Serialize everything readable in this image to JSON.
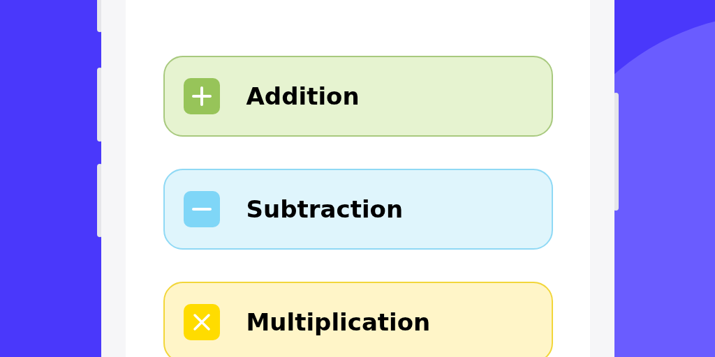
{
  "operations": [
    {
      "label": "Addition",
      "kind": "plus",
      "color": "#97c459"
    },
    {
      "label": "Subtraction",
      "kind": "minus",
      "color": "#7fd6f7"
    },
    {
      "label": "Multiplication",
      "kind": "times",
      "color": "#ffdc00"
    }
  ]
}
